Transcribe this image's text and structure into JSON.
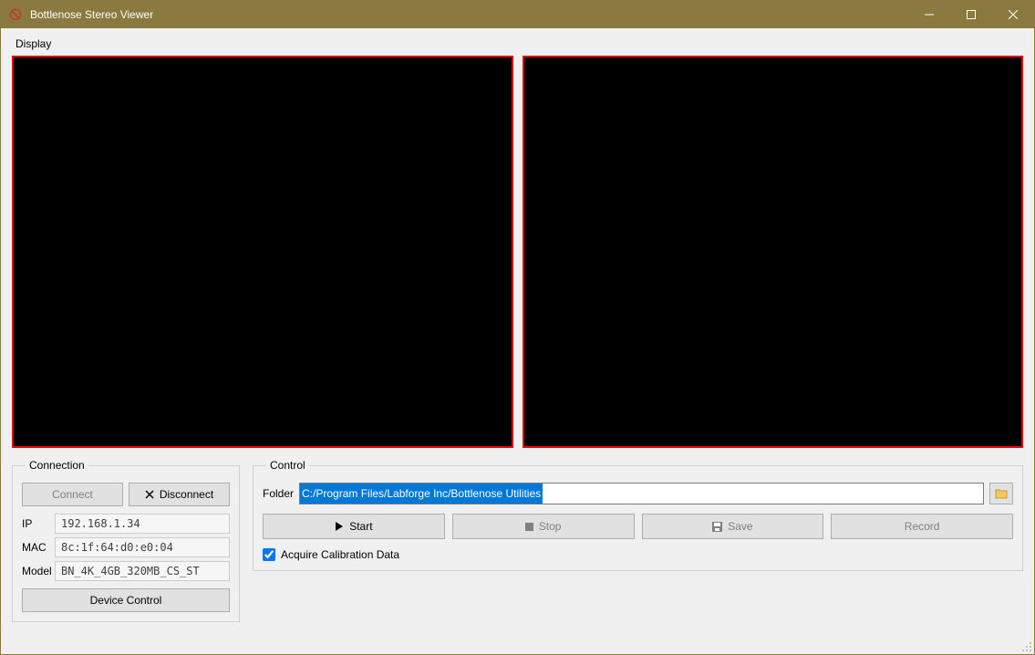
{
  "window": {
    "title": "Bottlenose Stereo Viewer"
  },
  "display": {
    "label": "Display"
  },
  "connection": {
    "legend": "Connection",
    "connect_label": "Connect",
    "disconnect_label": "Disconnect",
    "ip_label": "IP",
    "ip_value": "192.168.1.34",
    "mac_label": "MAC",
    "mac_value": "8c:1f:64:d0:e0:04",
    "model_label": "Model",
    "model_value": "BN_4K_4GB_320MB_CS_ST",
    "device_control_label": "Device Control"
  },
  "control": {
    "legend": "Control",
    "folder_label": "Folder",
    "folder_value": "C:/Program Files/Labforge Inc/Bottlenose Utilities",
    "start_label": "Start",
    "stop_label": "Stop",
    "save_label": "Save",
    "record_label": "Record",
    "acquire_label": "Acquire Calibration Data",
    "acquire_checked": true
  }
}
